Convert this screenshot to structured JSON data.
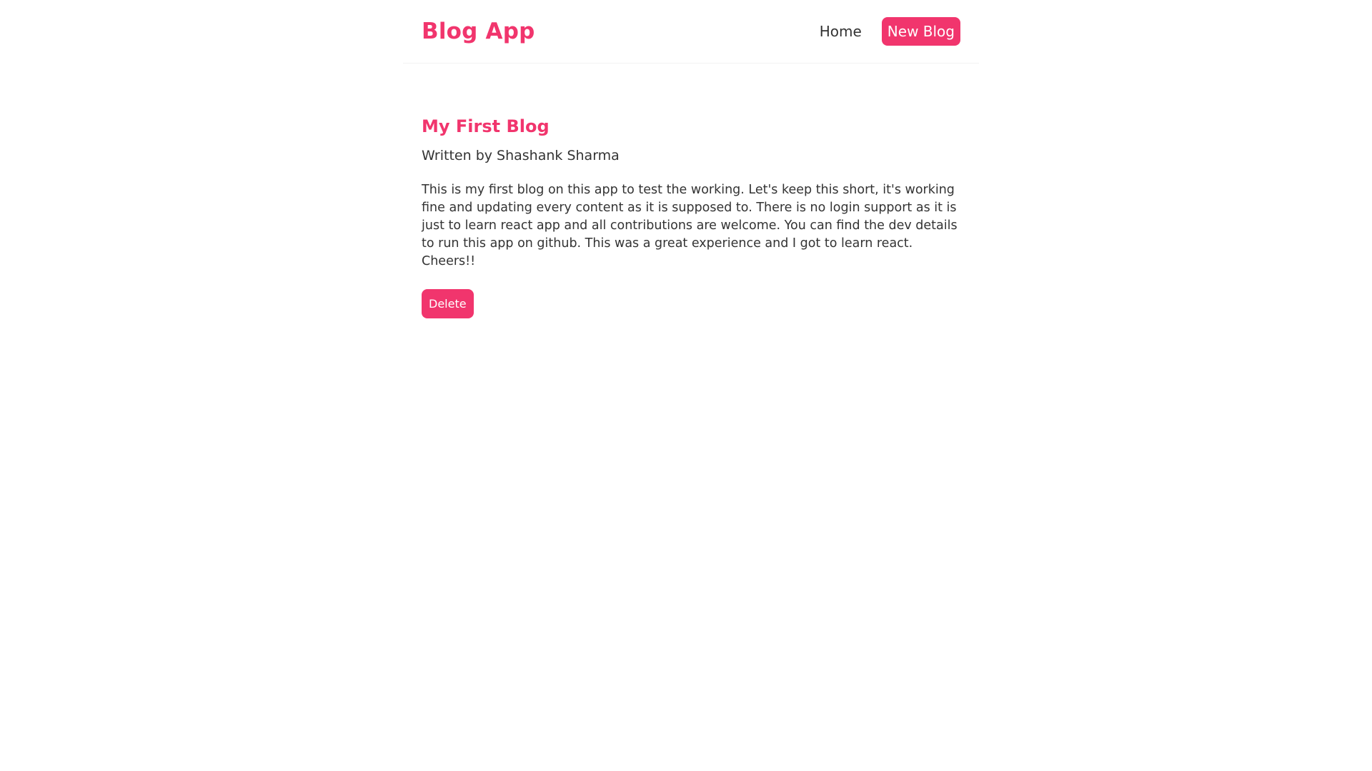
{
  "navbar": {
    "brand": "Blog App",
    "links": {
      "home": "Home",
      "new_blog": "New Blog"
    }
  },
  "blog": {
    "title": "My First Blog",
    "author": "Written by Shashank Sharma",
    "body": "This is my first blog on this app to test the working. Let's keep this short, it's working fine and updating every content as it is supposed to. There is no login support as it is just to learn react app and all contributions are welcome. You can find the dev details to run this app on github. This was a great experience and I got to learn react. Cheers!!",
    "delete_label": "Delete"
  },
  "colors": {
    "accent": "#f1356d",
    "text": "#333333",
    "background": "#ffffff"
  }
}
